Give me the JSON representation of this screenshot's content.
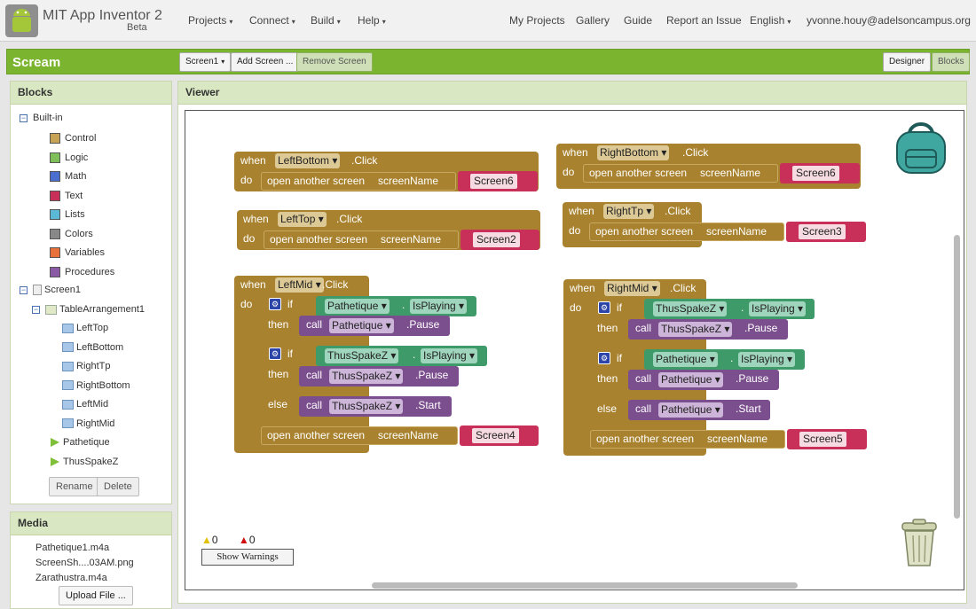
{
  "header": {
    "title": "MIT App Inventor 2",
    "beta": "Beta",
    "menus": [
      "Projects",
      "Connect",
      "Build",
      "Help"
    ],
    "links": [
      "My Projects",
      "Gallery",
      "Guide",
      "Report an Issue"
    ],
    "language": "English",
    "user": "yvonne.houy@adelsoncampus.org"
  },
  "project": {
    "name": "Scream",
    "screen_select": "Screen1",
    "add_screen": "Add Screen ...",
    "remove_screen": "Remove Screen",
    "designer": "Designer",
    "blocks": "Blocks"
  },
  "blocks_panel": {
    "title": "Blocks",
    "builtin": "Built-in",
    "builtins": [
      {
        "label": "Control",
        "color": "#c7a455"
      },
      {
        "label": "Logic",
        "color": "#7fbf5a"
      },
      {
        "label": "Math",
        "color": "#4a6fcf"
      },
      {
        "label": "Text",
        "color": "#c8305a"
      },
      {
        "label": "Lists",
        "color": "#5bb9d8"
      },
      {
        "label": "Colors",
        "color": "#888888"
      },
      {
        "label": "Variables",
        "color": "#e8703a"
      },
      {
        "label": "Procedures",
        "color": "#8a5aa5"
      }
    ],
    "screen": "Screen1",
    "arrangement": "TableArrangement1",
    "components": [
      "LeftTop",
      "LeftBottom",
      "RightTp",
      "RightBottom",
      "LeftMid",
      "RightMid"
    ],
    "players": [
      "Pathetique",
      "ThusSpakeZ"
    ],
    "rename": "Rename",
    "delete": "Delete"
  },
  "media": {
    "title": "Media",
    "files": [
      "Pathetique1.m4a",
      "ScreenSh....03AM.png",
      "Zarathustra.m4a"
    ],
    "upload": "Upload File ..."
  },
  "viewer": {
    "title": "Viewer",
    "warnings": "0",
    "errors": "0",
    "show_warnings": "Show Warnings"
  },
  "code": {
    "when": "when",
    "do": "do",
    "click": ".Click",
    "open": "open another screen",
    "screen_name": "screenName",
    "if": "if",
    "then": "then",
    "else": "else",
    "call": "call",
    "dot": ".",
    "isplaying": "IsPlaying",
    "pause": ".Pause",
    "start": ".Start",
    "lb": {
      "comp": "LeftBottom",
      "screen": "Screen6"
    },
    "lt": {
      "comp": "LeftTop",
      "screen": "Screen2"
    },
    "lm": {
      "comp": "LeftMid",
      "p1": "Pathetique",
      "p2": "Pathetique",
      "p3": "ThusSpakeZ",
      "p4": "ThusSpakeZ",
      "p5": "ThusSpakeZ",
      "screen": "Screen4"
    },
    "rb": {
      "comp": "RightBottom",
      "screen": "Screen6"
    },
    "rt": {
      "comp": "RightTp",
      "screen": "Screen3"
    },
    "rm": {
      "comp": "RightMid",
      "p1": "ThusSpakeZ",
      "p2": "ThusSpakeZ",
      "p3": "Pathetique",
      "p4": "Pathetique",
      "p5": "Pathetique",
      "screen": "Screen5"
    }
  }
}
